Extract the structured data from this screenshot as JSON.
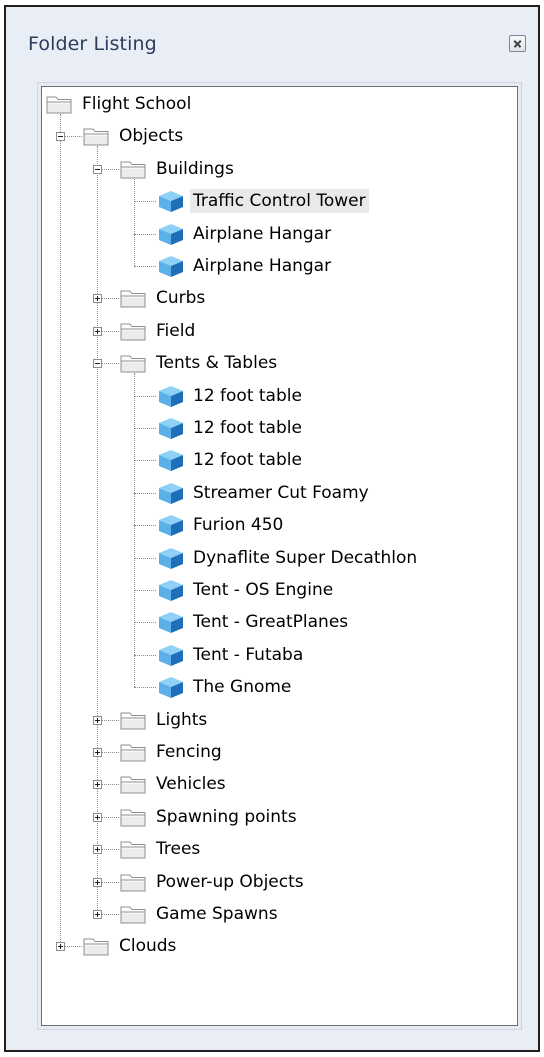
{
  "window": {
    "title": "Folder Listing",
    "close_icon": "close-icon"
  },
  "tree": {
    "root": {
      "label": "Flight School",
      "icon": "folder-icon",
      "expanded": true,
      "children": [
        {
          "label": "Objects",
          "icon": "folder-icon",
          "expanded": true,
          "children": [
            {
              "label": "Buildings",
              "icon": "folder-icon",
              "expanded": true,
              "children": [
                {
                  "label": "Traffic Control Tower",
                  "icon": "cube-icon",
                  "selected": true
                },
                {
                  "label": "Airplane Hangar",
                  "icon": "cube-icon"
                },
                {
                  "label": "Airplane Hangar",
                  "icon": "cube-icon"
                }
              ]
            },
            {
              "label": "Curbs",
              "icon": "folder-icon",
              "expanded": false
            },
            {
              "label": "Field",
              "icon": "folder-icon",
              "expanded": false
            },
            {
              "label": "Tents & Tables",
              "icon": "folder-icon",
              "expanded": true,
              "children": [
                {
                  "label": "12 foot table",
                  "icon": "cube-icon"
                },
                {
                  "label": "12 foot table",
                  "icon": "cube-icon"
                },
                {
                  "label": "12 foot table",
                  "icon": "cube-icon"
                },
                {
                  "label": "Streamer Cut Foamy",
                  "icon": "cube-icon"
                },
                {
                  "label": "Furion 450",
                  "icon": "cube-icon"
                },
                {
                  "label": "Dynaflite Super Decathlon",
                  "icon": "cube-icon"
                },
                {
                  "label": "Tent - OS Engine",
                  "icon": "cube-icon"
                },
                {
                  "label": "Tent - GreatPlanes",
                  "icon": "cube-icon"
                },
                {
                  "label": "Tent - Futaba",
                  "icon": "cube-icon"
                },
                {
                  "label": "The Gnome",
                  "icon": "cube-icon"
                }
              ]
            },
            {
              "label": "Lights",
              "icon": "folder-icon",
              "expanded": false
            },
            {
              "label": "Fencing",
              "icon": "folder-icon",
              "expanded": false
            },
            {
              "label": "Vehicles",
              "icon": "folder-icon",
              "expanded": false
            },
            {
              "label": "Spawning points",
              "icon": "folder-icon",
              "expanded": false
            },
            {
              "label": "Trees",
              "icon": "folder-icon",
              "expanded": false
            },
            {
              "label": "Power-up Objects",
              "icon": "folder-icon",
              "expanded": false
            },
            {
              "label": "Game Spawns",
              "icon": "folder-icon",
              "expanded": false
            }
          ]
        },
        {
          "label": "Clouds",
          "icon": "folder-icon",
          "expanded": false
        }
      ]
    }
  },
  "colors": {
    "title_text": "#2b3d5a",
    "window_bg": "#e9eef6",
    "selection_bg": "#e9e9e9",
    "cube_light": "#5bb0ea",
    "cube_dark": "#1f6fb8"
  }
}
